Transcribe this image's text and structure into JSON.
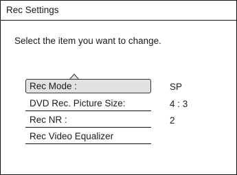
{
  "window": {
    "title": "Rec Settings"
  },
  "instruction": "Select the item you want to change.",
  "menu": {
    "items": [
      {
        "label": "Rec Mode :",
        "value": "SP"
      },
      {
        "label": "DVD Rec. Picture Size:",
        "value": "4 : 3"
      },
      {
        "label": "Rec NR :",
        "value": "2"
      },
      {
        "label": "Rec Video Equalizer"
      }
    ]
  },
  "icons": {
    "scroll_up": "caret-up-icon"
  }
}
